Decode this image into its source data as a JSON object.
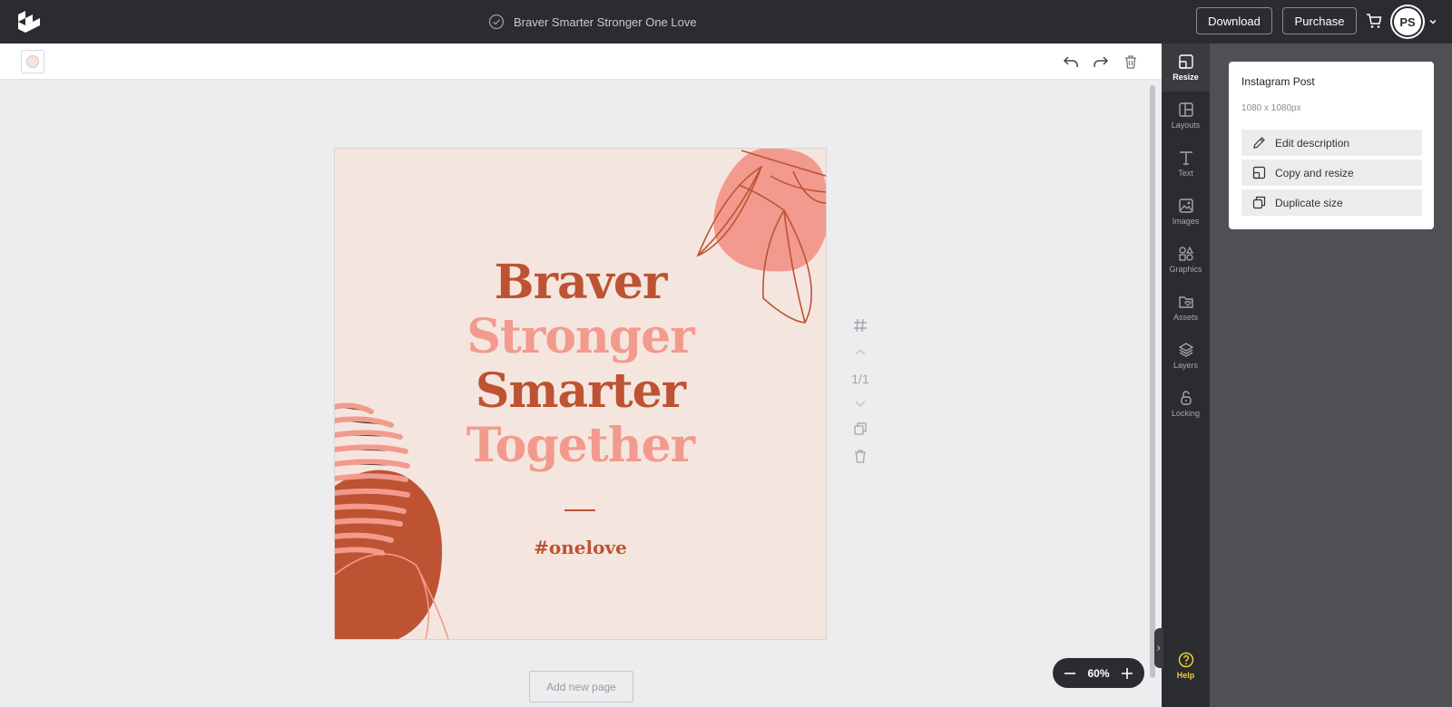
{
  "topbar": {
    "document_title": "Braver Smarter Stronger One Love",
    "download_label": "Download",
    "purchase_label": "Purchase",
    "avatar_initials": "PS"
  },
  "design": {
    "lines": [
      {
        "text": "Braver",
        "tone": "dark"
      },
      {
        "text": "Stronger",
        "tone": "light"
      },
      {
        "text": "Smarter",
        "tone": "dark"
      },
      {
        "text": "Together",
        "tone": "light"
      }
    ],
    "hashtag": "#onelove",
    "colors": {
      "background": "#f4e6df",
      "dark": "#bd5332",
      "light": "#f39a8e"
    }
  },
  "canvas": {
    "page_counter": "1/1",
    "add_page_label": "Add new page",
    "zoom_label": "60%"
  },
  "sidenav": {
    "items": [
      {
        "label": "Resize",
        "icon": "resize-icon"
      },
      {
        "label": "Layouts",
        "icon": "layouts-icon"
      },
      {
        "label": "Text",
        "icon": "text-icon"
      },
      {
        "label": "Images",
        "icon": "image-icon"
      },
      {
        "label": "Graphics",
        "icon": "shapes-icon"
      },
      {
        "label": "Assets",
        "icon": "folder-icon"
      },
      {
        "label": "Layers",
        "icon": "layers-icon"
      },
      {
        "label": "Locking",
        "icon": "lock-icon"
      }
    ],
    "help_label": "Help"
  },
  "resize_panel": {
    "title": "Instagram Post",
    "size": "1080 x 1080px",
    "actions": [
      {
        "label": "Edit description",
        "icon": "pencil-icon"
      },
      {
        "label": "Copy and resize",
        "icon": "copy-resize-icon"
      },
      {
        "label": "Duplicate size",
        "icon": "duplicate-icon"
      }
    ]
  }
}
